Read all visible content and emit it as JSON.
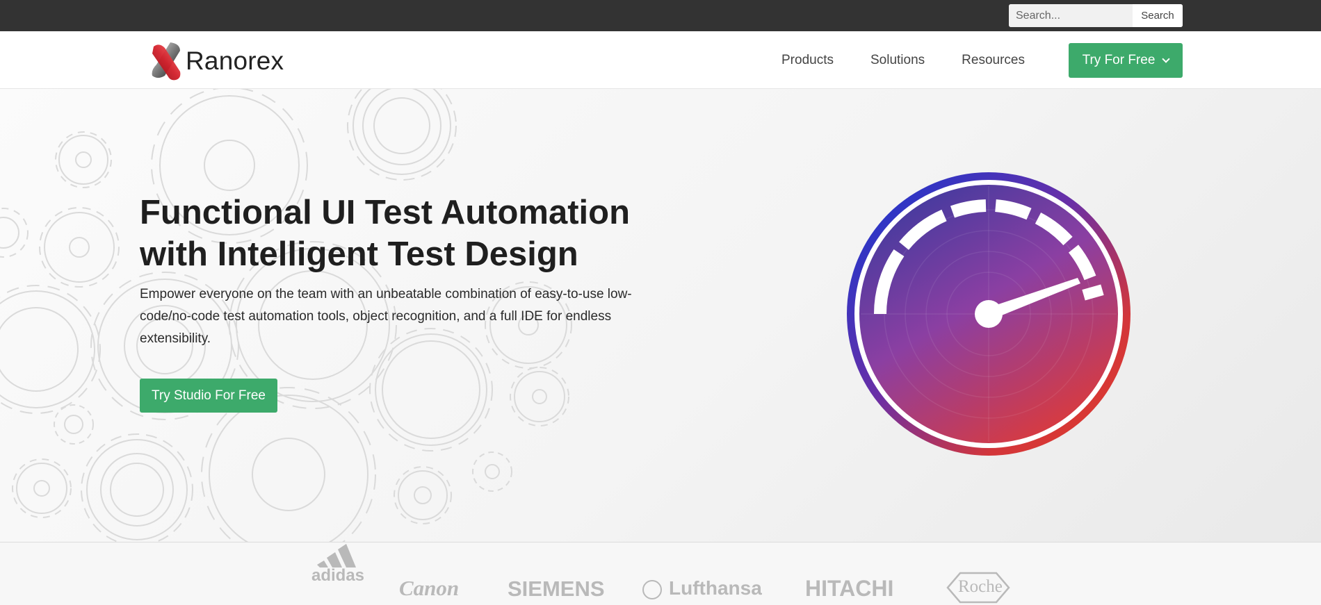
{
  "topbar": {
    "search": {
      "placeholder": "Search...",
      "value": "",
      "button_label": "Search"
    }
  },
  "navbar": {
    "logo_text": "Ranorex",
    "links": [
      "Products",
      "Solutions",
      "Resources"
    ],
    "cta_label": "Try For Free"
  },
  "hero": {
    "title_line1": "Functional UI Test Automation",
    "title_line2": "with Intelligent Test Design",
    "description": "Empower everyone on the team with an unbeatable combination of easy-to-use low-code/no-code test automation tools, object recognition, and a full IDE for endless extensibility.",
    "cta_label": "Try Studio For Free"
  },
  "clients": [
    "adidas",
    "Canon",
    "SIEMENS",
    "Lufthansa",
    "HITACHI",
    "Roche"
  ],
  "colors": {
    "topbar": "#333333",
    "accent_green": "#3daa6b",
    "gauge_blue": "#1e37c8",
    "gauge_red": "#d93a2f"
  },
  "icons": [
    "ranorex-logo-icon",
    "chevron-down-icon",
    "speedometer-icon",
    "gears-background",
    "adidas-logo",
    "lufthansa-crane-icon",
    "roche-hexagon"
  ]
}
